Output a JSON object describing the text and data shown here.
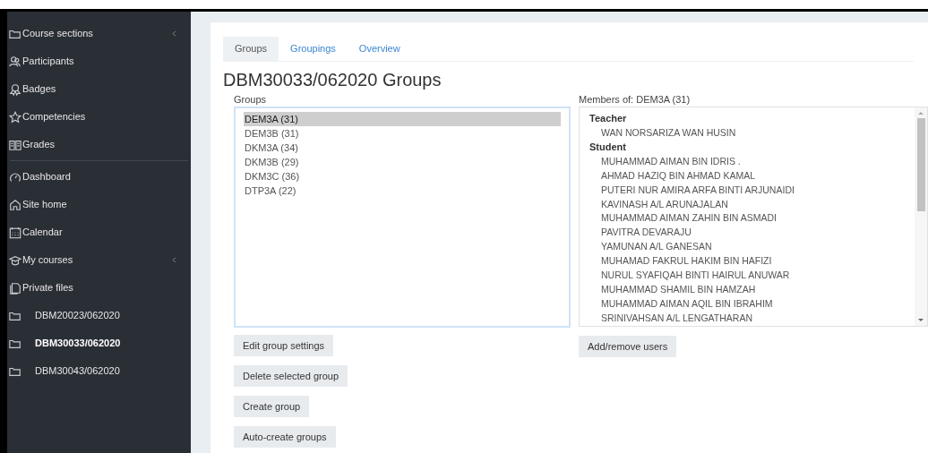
{
  "sidebar": {
    "sections": [
      {
        "items": [
          {
            "label": "Course sections",
            "submenu": true,
            "selected": false
          },
          {
            "label": "Participants",
            "submenu": false,
            "selected": false
          },
          {
            "label": "Badges",
            "submenu": false,
            "selected": false
          },
          {
            "label": "Competencies",
            "submenu": false,
            "selected": false
          },
          {
            "label": "Grades",
            "submenu": false,
            "selected": false
          }
        ]
      },
      {
        "items": [
          {
            "label": "Dashboard",
            "submenu": false,
            "selected": false
          },
          {
            "label": "Site home",
            "submenu": false,
            "selected": false
          },
          {
            "label": "Calendar",
            "submenu": false,
            "selected": false
          },
          {
            "label": "My courses",
            "submenu": true,
            "selected": false
          },
          {
            "label": "Private files",
            "submenu": false,
            "selected": false
          }
        ]
      }
    ],
    "courses": [
      {
        "label": "DBM20023/062020",
        "selected": false
      },
      {
        "label": "DBM30033/062020",
        "selected": true
      },
      {
        "label": "DBM30043/062020",
        "selected": false
      }
    ]
  },
  "tabs": [
    {
      "label": "Groups",
      "selected": true
    },
    {
      "label": "Groupings",
      "selected": false
    },
    {
      "label": "Overview",
      "selected": false
    }
  ],
  "heading": "DBM30033/062020 Groups",
  "groups": {
    "label": "Groups",
    "items": [
      {
        "label": "DEM3A (31)",
        "selected": true
      },
      {
        "label": "DEM3B (31)",
        "selected": false
      },
      {
        "label": "DKM3A (34)",
        "selected": false
      },
      {
        "label": "DKM3B (29)",
        "selected": false
      },
      {
        "label": "DKM3C (36)",
        "selected": false
      },
      {
        "label": "DTP3A (22)",
        "selected": false
      }
    ],
    "buttons": [
      "Edit group settings",
      "Delete selected group",
      "Create group",
      "Auto-create groups"
    ]
  },
  "members": {
    "label": "Members of: DEM3A (31)",
    "roles": [
      {
        "role": "Teacher",
        "people": [
          "WAN NORSARIZA WAN HUSIN"
        ]
      },
      {
        "role": "Student",
        "people": [
          "MUHAMMAD AIMAN BIN IDRIS .",
          "AHMAD HAZIQ BIN AHMAD KAMAL",
          "PUTERI NUR AMIRA ARFA BINTI ARJUNAIDI",
          "KAVINASH A/L ARUNAJALAN",
          "MUHAMMAD AIMAN ZAHIN BIN ASMADI",
          "PAVITRA DEVARAJU",
          "YAMUNAN A/L GANESAN",
          "MUHAMAD FAKRUL HAKIM BIN HAFIZI",
          "NURUL SYAFIQAH BINTI HAIRUL ANUWAR",
          "MUHAMMAD SHAMIL BIN HAMZAH",
          "MUHAMMAD AIMAN AQIL BIN IBRAHIM",
          "SRINIVAHSAN A/L LENGATHARAN"
        ]
      }
    ],
    "buttons": [
      "Add/remove users"
    ]
  }
}
